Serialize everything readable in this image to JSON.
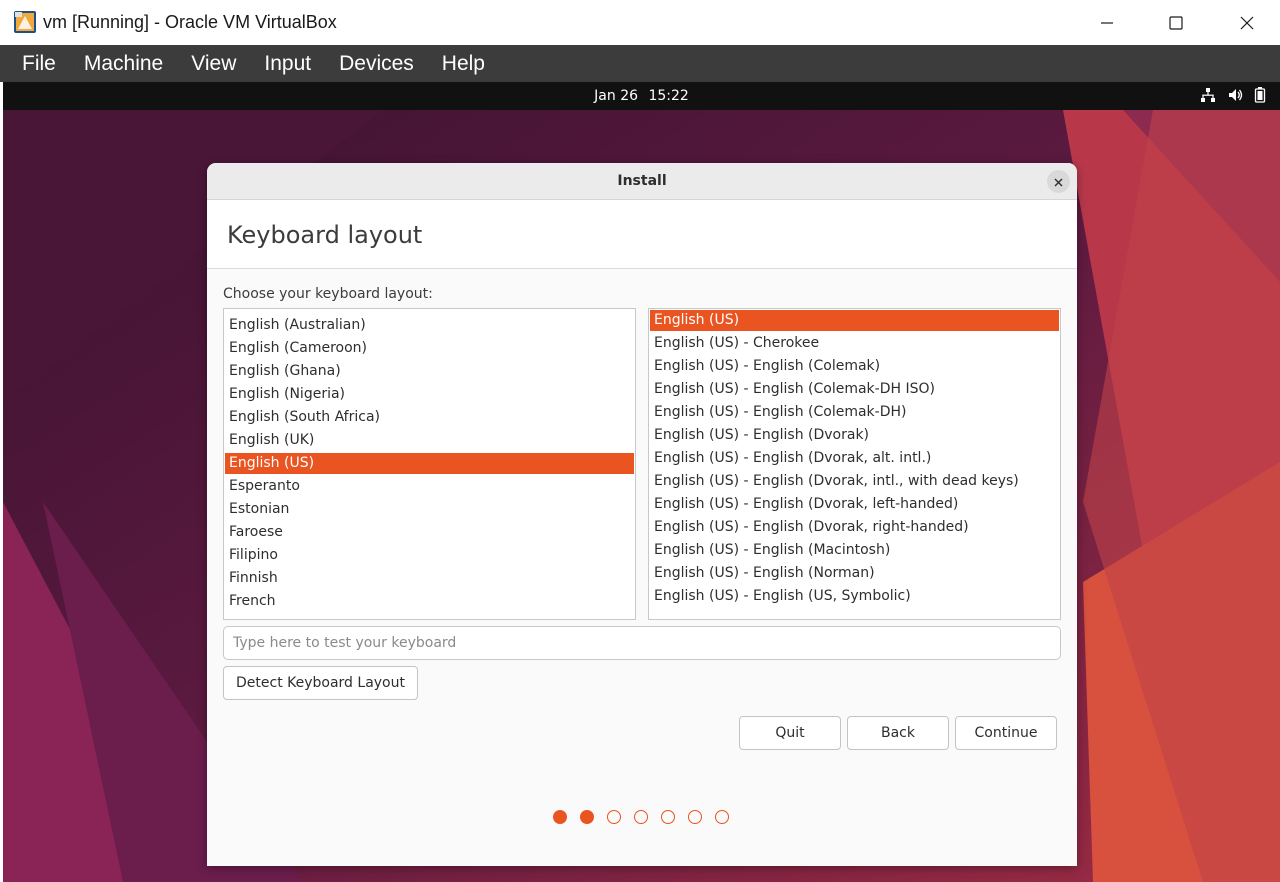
{
  "window": {
    "title": "vm [Running] - Oracle VM VirtualBox",
    "app_icon": "virtualbox-icon",
    "controls": [
      "minimize-icon",
      "maximize-icon",
      "close-icon"
    ]
  },
  "menubar": {
    "items": [
      "File",
      "Machine",
      "View",
      "Input",
      "Devices",
      "Help"
    ]
  },
  "guest_topbar": {
    "date": "Jan 26",
    "time": "15:22",
    "tray_icons": [
      "network-icon",
      "volume-icon",
      "battery-icon"
    ]
  },
  "dialog": {
    "title": "Install",
    "page_title": "Keyboard layout",
    "prompt": "Choose your keyboard layout:",
    "layouts": [
      "English (Australian)",
      "English (Cameroon)",
      "English (Ghana)",
      "English (Nigeria)",
      "English (South Africa)",
      "English (UK)",
      "English (US)",
      "Esperanto",
      "Estonian",
      "Faroese",
      "Filipino",
      "Finnish",
      "French"
    ],
    "layouts_selected": "English (US)",
    "variants": [
      "English (US)",
      "English (US) - Cherokee",
      "English (US) - English (Colemak)",
      "English (US) - English (Colemak-DH ISO)",
      "English (US) - English (Colemak-DH)",
      "English (US) - English (Dvorak)",
      "English (US) - English (Dvorak, alt. intl.)",
      "English (US) - English (Dvorak, intl., with dead keys)",
      "English (US) - English (Dvorak, left-handed)",
      "English (US) - English (Dvorak, right-handed)",
      "English (US) - English (Macintosh)",
      "English (US) - English (Norman)",
      "English (US) - English (US, Symbolic)"
    ],
    "variants_selected": "English (US)",
    "test_input": {
      "value": "",
      "placeholder": "Type here to test your keyboard"
    },
    "detect_button": "Detect Keyboard Layout",
    "buttons": {
      "quit": "Quit",
      "back": "Back",
      "continue": "Continue"
    },
    "progress": {
      "total_steps": 7,
      "completed_steps": 2
    }
  },
  "colors": {
    "accent": "#e95420",
    "menubar_bg": "#3c3c3c",
    "guest_topbar_bg": "#111111",
    "wallpaper": [
      "#3e1532",
      "#7a1d45",
      "#d24a42"
    ]
  }
}
